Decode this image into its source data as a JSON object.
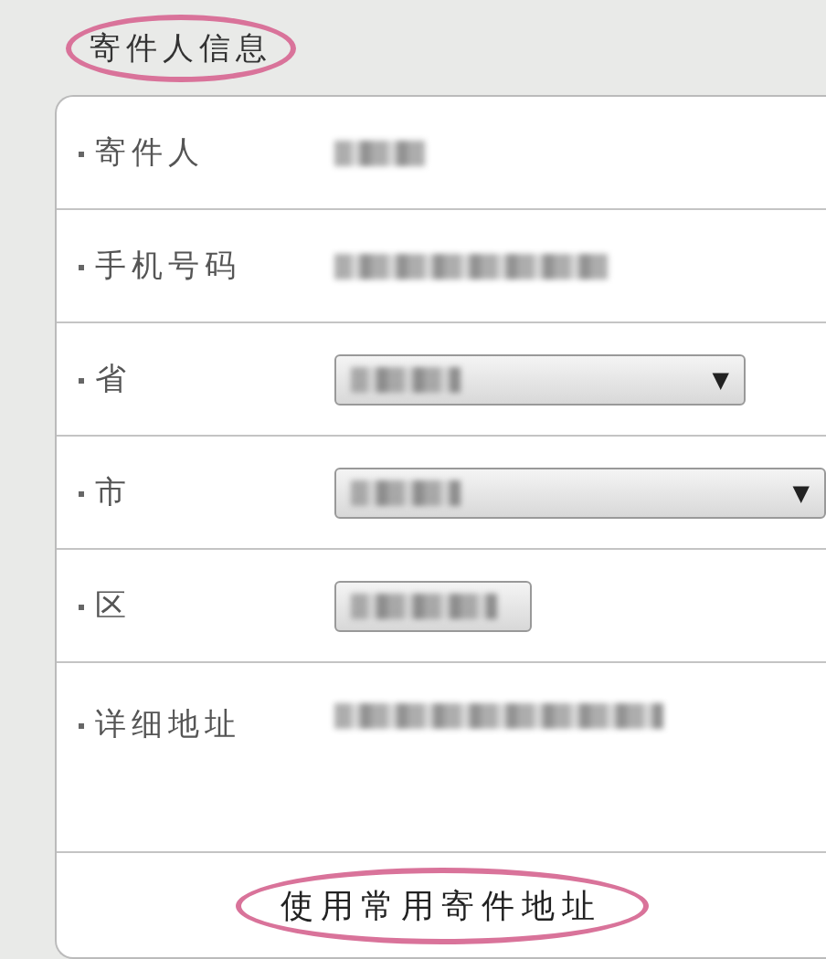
{
  "section_title": "寄件人信息",
  "fields": [
    {
      "label": "寄件人",
      "kind": "text"
    },
    {
      "label": "手机号码",
      "kind": "text"
    },
    {
      "label": "省",
      "kind": "select",
      "caret": "▼"
    },
    {
      "label": "市",
      "kind": "select",
      "caret": "▼"
    },
    {
      "label": "区",
      "kind": "spinner"
    },
    {
      "label": "详细地址",
      "kind": "textarea"
    }
  ],
  "action_button": "使用常用寄件地址"
}
